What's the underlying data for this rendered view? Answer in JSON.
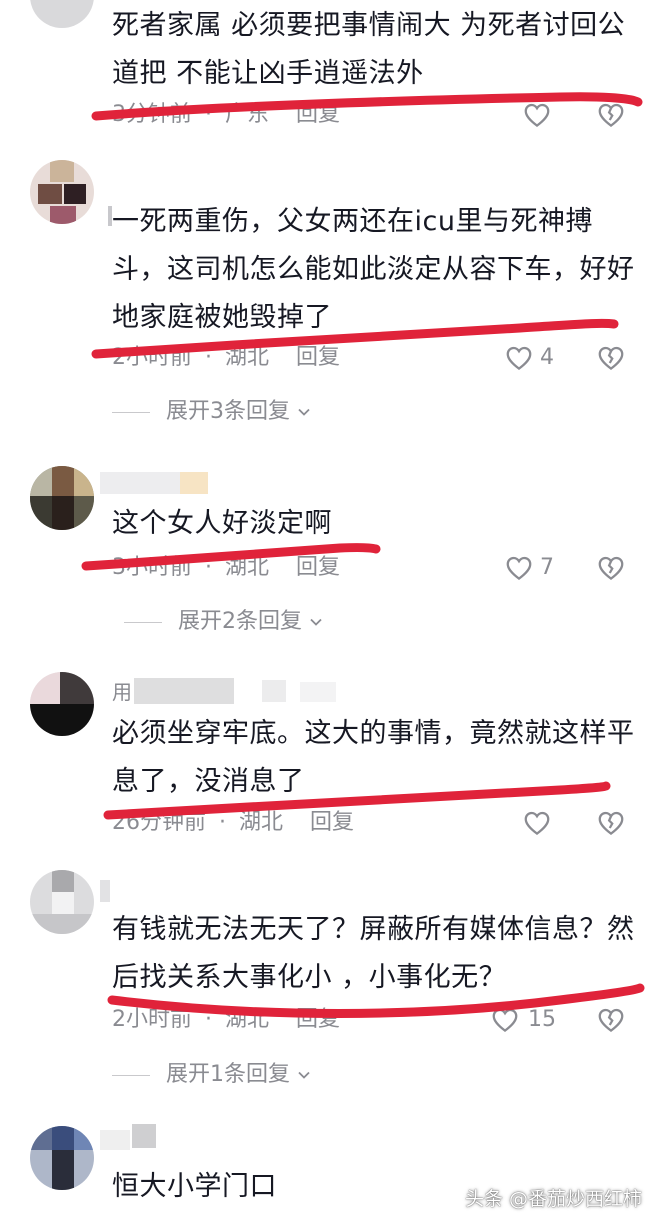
{
  "comments": [
    {
      "text": "死者家属  必须要把事情闹大  为死者讨回公道把  不能让凶手逍遥法外",
      "time": "3分钟前",
      "location": "广东",
      "reply_label": "回复",
      "like_count": "",
      "expand_label": ""
    },
    {
      "text": "一死两重伤，父女两还在icu里与死神搏斗，这司机怎么能如此淡定从容下车，好好地家庭被她毁掉了",
      "time": "2小时前",
      "location": "湖北",
      "reply_label": "回复",
      "like_count": "4",
      "expand_label": "展开3条回复"
    },
    {
      "text": "这个女人好淡定啊",
      "time": "3小时前",
      "location": "湖北",
      "reply_label": "回复",
      "like_count": "7",
      "expand_label": "展开2条回复"
    },
    {
      "username": "用",
      "text": "必须坐穿牢底。这大的事情，竟然就这样平息了，没消息了",
      "time": "26分钟前",
      "location": "湖北",
      "reply_label": "回复",
      "like_count": "",
      "expand_label": ""
    },
    {
      "text": "有钱就无法无天了？屏蔽所有媒体信息？然后找关系大事化小 ，小事化无？",
      "time": "2小时前",
      "location": "湖北",
      "reply_label": "回复",
      "like_count": "15",
      "expand_label": "展开1条回复"
    },
    {
      "text": "恒大小学门口"
    }
  ],
  "separator": "·",
  "watermark": "头条 @番茄炒西红柿",
  "colors": {
    "underline": "#e0233a",
    "meta": "#8a8b91",
    "text": "#161823"
  },
  "icons": [
    "heart-outline-icon",
    "broken-heart-icon",
    "chevron-down-icon"
  ]
}
